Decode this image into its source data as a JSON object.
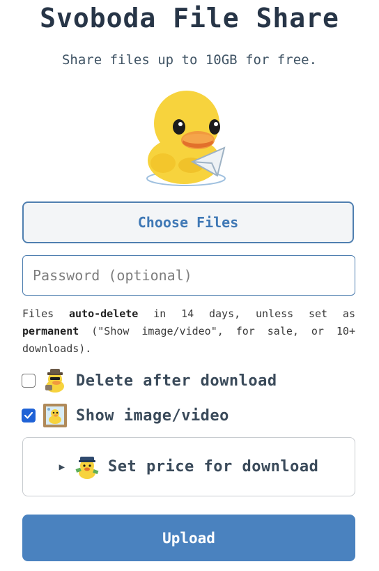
{
  "header": {
    "title": "Svoboda File Share",
    "subtitle": "Share files up to 10GB for free."
  },
  "mascot": {
    "icon": "duck-holding-paper-plane-icon"
  },
  "upload_form": {
    "choose_files_label": "Choose Files",
    "password_placeholder": "Password (optional)",
    "password_value": "",
    "notice": {
      "part1": "Files ",
      "bold1": "auto-delete",
      "part2": " in 14 days, unless set as ",
      "bold2": "permanent",
      "part3": " (\"Show image/video\", for sale, or 10+ downloads)."
    },
    "options": [
      {
        "label": "Delete after download",
        "checked": false,
        "icon": "detective-duck-icon"
      },
      {
        "label": "Show image/video",
        "checked": true,
        "icon": "duck-picture-frame-icon"
      }
    ],
    "price": {
      "label": "Set price for download",
      "expanded": false,
      "icon": "duck-with-money-icon"
    },
    "upload_label": "Upload"
  },
  "colors": {
    "accent": "#4a82bf",
    "checkbox": "#1f62d6",
    "duck_yellow": "#f7d33d",
    "beak_orange": "#f19a3e"
  }
}
